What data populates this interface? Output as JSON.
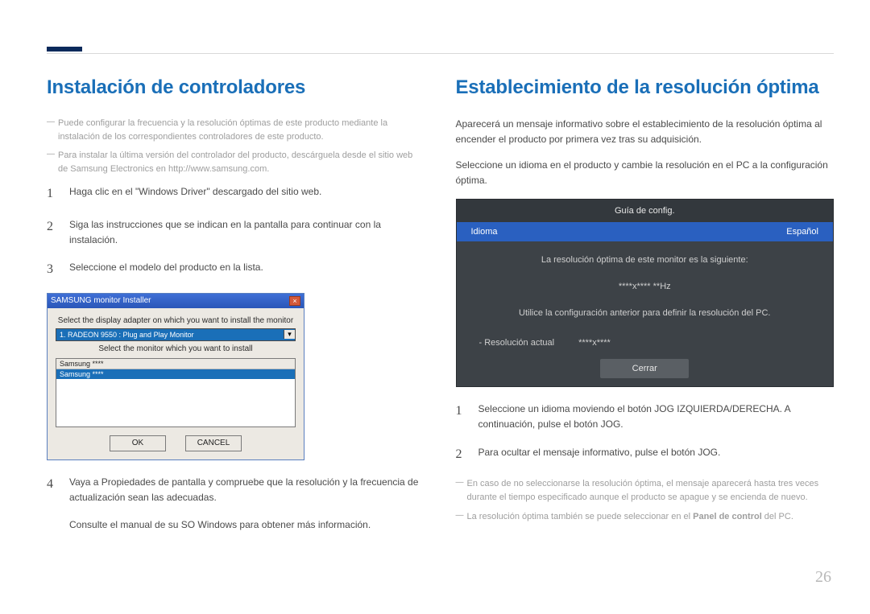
{
  "page_number": "26",
  "left": {
    "heading": "Instalación de controladores",
    "notes": [
      "Puede configurar la frecuencia y la resolución óptimas de este producto mediante la instalación de los correspondientes controladores de este producto.",
      "Para instalar la última versión del controlador del producto, descárguela desde el sitio web de Samsung Electronics en http://www.samsung.com."
    ],
    "steps": [
      "Haga clic en el \"Windows Driver\" descargado del sitio web.",
      "Siga las instrucciones que se indican en la pantalla para continuar con la instalación.",
      "Seleccione el modelo del producto en la lista.",
      "Vaya a Propiedades de pantalla y compruebe que la resolución y la frecuencia de actualización sean las adecuadas."
    ],
    "after_step4": "Consulte el manual de su SO Windows para obtener más información.",
    "installer": {
      "title": "SAMSUNG monitor Installer",
      "label1": "Select the display adapter on which you want to install the monitor",
      "dropdown": "1. RADEON 9550 : Plug and Play Monitor",
      "label2": "Select the monitor which you want to install",
      "list_header": "Samsung ****",
      "list_item": "Samsung ****",
      "ok": "OK",
      "cancel": "CANCEL"
    }
  },
  "right": {
    "heading": "Establecimiento de la resolución óptima",
    "intro1": "Aparecerá un mensaje informativo sobre el establecimiento de la resolución óptima al encender el producto por primera vez tras su adquisición.",
    "intro2": "Seleccione un idioma en el producto y cambie la resolución en el PC a la configuración óptima.",
    "osd": {
      "title": "Guía de config.",
      "row_left": "Idioma",
      "row_right": "Español",
      "msg1": "La resolución óptima de este monitor es la siguiente:",
      "msg2": "****x**** **Hz",
      "msg3": "Utilice la configuración anterior para definir la resolución del PC.",
      "res_label": "Resolución actual",
      "res_value": "****x****",
      "close": "Cerrar"
    },
    "steps": [
      "Seleccione un idioma moviendo el botón JOG IZQUIERDA/DERECHA. A continuación, pulse el botón JOG.",
      "Para ocultar el mensaje informativo, pulse el botón JOG."
    ],
    "notes_below": [
      "En caso de no seleccionarse la resolución óptima, el mensaje aparecerá hasta tres veces durante el tiempo especificado aunque el producto se apague y se encienda de nuevo."
    ],
    "note_panel_pre": "La resolución óptima también se puede seleccionar en el ",
    "note_panel_bold": "Panel de control",
    "note_panel_post": " del PC."
  }
}
